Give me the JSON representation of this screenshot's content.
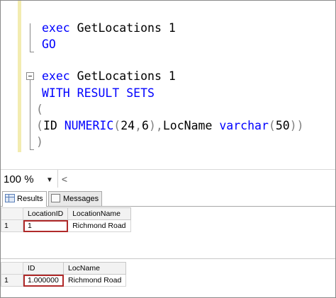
{
  "editor": {
    "lines": [
      {
        "parts": [
          {
            "t": "exec",
            "c": "kw"
          },
          {
            "t": " GetLocations 1",
            "c": ""
          }
        ]
      },
      {
        "parts": [
          {
            "t": "GO",
            "c": "kw"
          }
        ]
      },
      {
        "parts": [
          {
            "t": "exec",
            "c": "kw"
          },
          {
            "t": " GetLocations 1",
            "c": ""
          }
        ]
      },
      {
        "parts": [
          {
            "t": "WITH RESULT SETS",
            "c": "kw"
          }
        ]
      },
      {
        "parts": [
          {
            "t": "(",
            "c": "op"
          }
        ]
      },
      {
        "parts": [
          {
            "t": "(",
            "c": "op"
          },
          {
            "t": "ID ",
            "c": ""
          },
          {
            "t": "NUMERIC",
            "c": "kw"
          },
          {
            "t": "(",
            "c": "op"
          },
          {
            "t": "24",
            "c": ""
          },
          {
            "t": ",",
            "c": "op"
          },
          {
            "t": "6",
            "c": ""
          },
          {
            "t": "),",
            "c": "op"
          },
          {
            "t": "LocName ",
            "c": ""
          },
          {
            "t": "varchar",
            "c": "kw"
          },
          {
            "t": "(",
            "c": "op"
          },
          {
            "t": "50",
            "c": ""
          },
          {
            "t": "))",
            "c": "op"
          }
        ]
      },
      {
        "parts": [
          {
            "t": ")",
            "c": "op"
          }
        ]
      }
    ]
  },
  "statusbar": {
    "zoom": "100 %",
    "zoom_arrow": "▼",
    "scroll_left": "<"
  },
  "tabs": [
    {
      "label": "Results",
      "active": true
    },
    {
      "label": "Messages",
      "active": false
    }
  ],
  "grid1": {
    "columns": [
      "LocationID",
      "LocationName"
    ],
    "rows": [
      {
        "num": "1",
        "cells": [
          "1",
          "Richmond Road"
        ]
      }
    ]
  },
  "grid2": {
    "columns": [
      "ID",
      "LocName"
    ],
    "rows": [
      {
        "num": "1",
        "cells": [
          "1.000000",
          "Richmond Road"
        ]
      }
    ]
  },
  "colors": {
    "keyword": "#0000ff",
    "operator": "#808080",
    "highlight": "#b02a2a",
    "margin": "#f3ecb0"
  }
}
